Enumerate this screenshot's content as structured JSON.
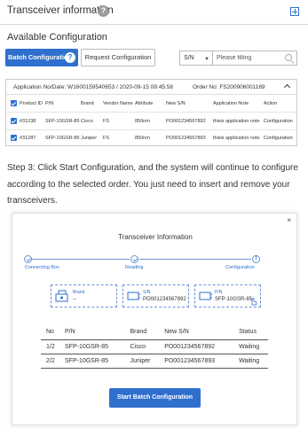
{
  "header": {
    "title": "Transceiver information",
    "help_glyph": "?"
  },
  "section_title": "Available Configuration",
  "tabs": {
    "batch_label": "Batch Configuration",
    "batch_help_glyph": "?",
    "request_label": "Request Configuration"
  },
  "search": {
    "field_value": "S/N",
    "placeholder": "Please filling"
  },
  "order": {
    "app_no": "Application No/Date: W1600159540653 / 2020-09-15 09:45:58",
    "order_no": "Order No: FS200906001169",
    "columns": [
      "Product ID",
      "P/N",
      "Brand",
      "Vendor Name",
      "Attribute",
      "New S/N",
      "Application Note",
      "Action"
    ],
    "rows": [
      {
        "product_id": "#31238",
        "pn": "SFP-10GSR-85",
        "brand": "Cisco",
        "vendor": "FS",
        "attribute": "850nm",
        "sn": "PO001234567892",
        "note": "thisis application note",
        "action": "Configuration"
      },
      {
        "product_id": "#31287",
        "pn": "SFP-10GSR-85",
        "brand": "Juniper",
        "vendor": "FS",
        "attribute": "850nm",
        "sn": "PO001234567893",
        "note": "thisis application note",
        "action": "Configuration"
      }
    ]
  },
  "step_text": "Step 3: Click Start Configuration, and the system will continue to configure according to the selected order. You just need to insert and remove your transceivers.",
  "dialog": {
    "close_glyph": "×",
    "title": "Transceiver Information",
    "steps": [
      "Connecting Box",
      "Reading",
      "Configuration"
    ],
    "cards": [
      {
        "label": "Brand",
        "value": "--"
      },
      {
        "label": "S/N",
        "value": "PO001234567892"
      },
      {
        "label": "P/N",
        "value": "SFP-10GSR-85"
      }
    ],
    "table": {
      "headers": [
        "No",
        "P/N",
        "Brand",
        "New S/N",
        "Status"
      ],
      "rows": [
        [
          "1/2",
          "SFP-10GSR-85",
          "Cisco",
          "PO001234567892",
          "Waiting"
        ],
        [
          "2/2",
          "SFP-10GSR-85",
          "Juniper",
          "PO001234567893",
          "Waiting"
        ]
      ]
    },
    "start_label": "Start Batch Configuration"
  },
  "colors": {
    "accent": "#2f6fce",
    "border": "#cccccc",
    "text": "#333333"
  },
  "icons": [
    "help-icon",
    "expand-icon",
    "chevron-down-icon",
    "search-icon",
    "chevron-up-icon",
    "checkbox-checked-icon",
    "close-icon",
    "box-icon",
    "transceiver-icon",
    "close-icon"
  ]
}
